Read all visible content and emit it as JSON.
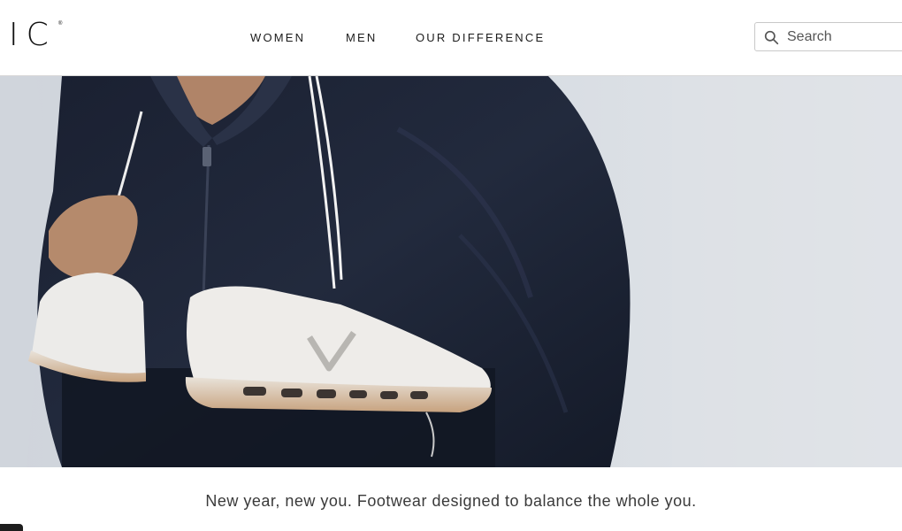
{
  "header": {
    "logo_text": "IC",
    "logo_mark": "®",
    "nav": [
      {
        "label": "WOMEN"
      },
      {
        "label": "MEN"
      },
      {
        "label": "OUR DIFFERENCE"
      }
    ],
    "search": {
      "placeholder": "Search",
      "icon": "search-icon"
    }
  },
  "hero": {
    "image": "person holding white sneakers over shoulder, dark jacket, sky background"
  },
  "tagline": "New year, new you. Footwear designed to balance the whole you."
}
